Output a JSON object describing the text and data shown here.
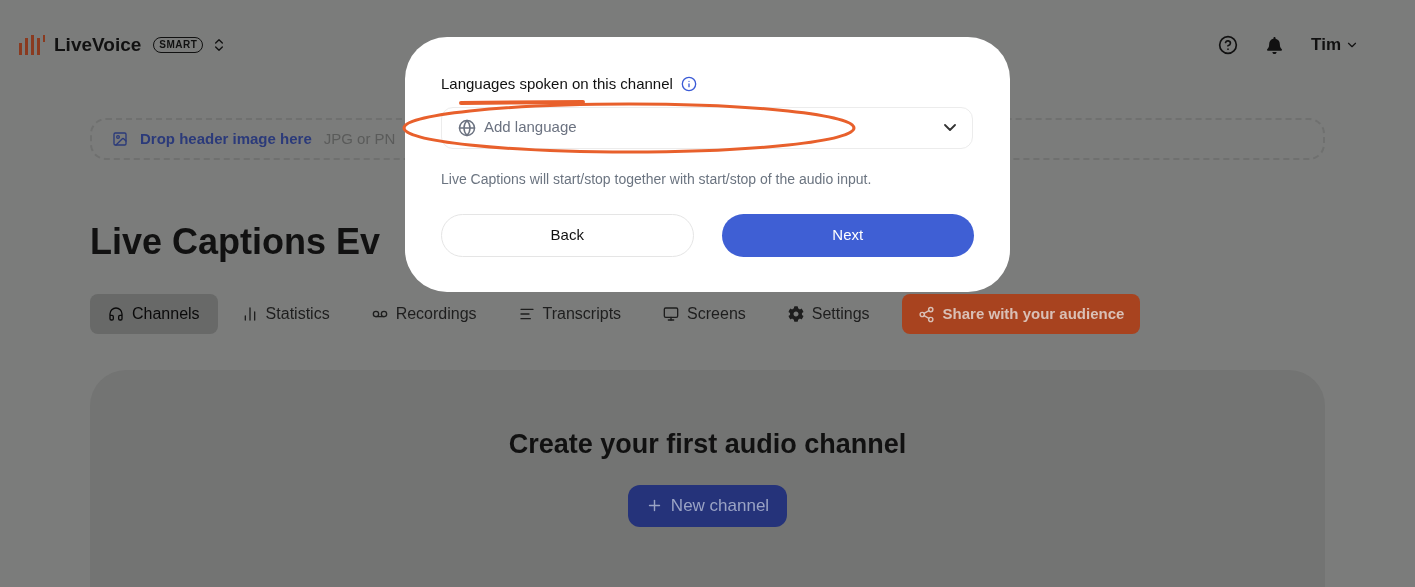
{
  "header": {
    "brand": "LiveVoice",
    "plan_badge": "SMART",
    "user": "Tim"
  },
  "header_image_drop": {
    "label": "Drop header image here",
    "hint": "JPG or PN"
  },
  "event_title": "Live Captions Ev",
  "tabs": [
    {
      "label": "Channels",
      "selected": true
    },
    {
      "label": "Statistics",
      "selected": false
    },
    {
      "label": "Recordings",
      "selected": false
    },
    {
      "label": "Transcripts",
      "selected": false
    },
    {
      "label": "Screens",
      "selected": false
    },
    {
      "label": "Settings",
      "selected": false
    }
  ],
  "share_button": "Share with your audience",
  "empty_state": {
    "title": "Create your first audio channel",
    "button": "New channel"
  },
  "dialog": {
    "field_label": "Languages spoken on this channel",
    "select": {
      "placeholder": "Add language"
    },
    "helper": "Live Captions will start/stop together with start/stop of the audio input.",
    "buttons": [
      {
        "label": "Back",
        "kind": "secondary"
      },
      {
        "label": "Next",
        "kind": "primary"
      }
    ],
    "highlighted": true
  }
}
